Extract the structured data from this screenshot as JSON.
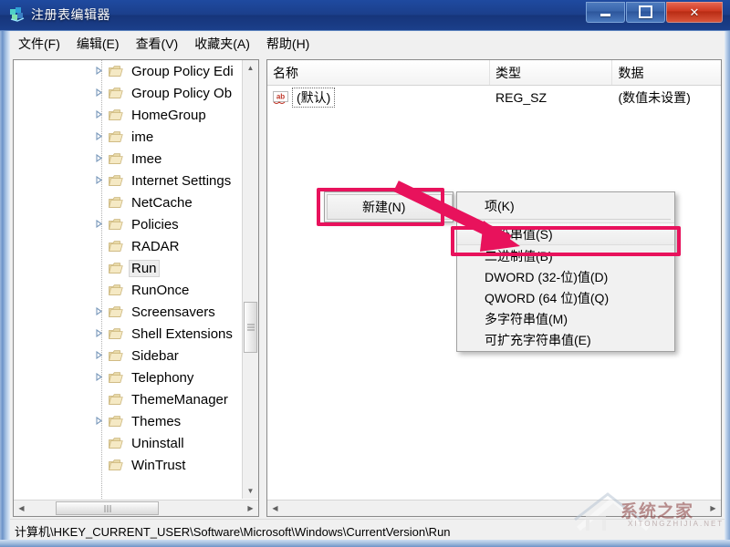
{
  "window": {
    "title": "注册表编辑器",
    "icon": "regedit-icon",
    "controls": {
      "minimize": "最小化",
      "maximize": "最大化",
      "close": "关闭",
      "close_glyph": "✕"
    }
  },
  "menubar": {
    "items": [
      {
        "label": "文件(F)",
        "name": "menu-file"
      },
      {
        "label": "编辑(E)",
        "name": "menu-edit"
      },
      {
        "label": "查看(V)",
        "name": "menu-view"
      },
      {
        "label": "收藏夹(A)",
        "name": "menu-favorites"
      },
      {
        "label": "帮助(H)",
        "name": "menu-help"
      }
    ]
  },
  "tree": {
    "items": [
      {
        "label": "Group Policy Edi",
        "expandable": true,
        "selected": false,
        "truncated": true
      },
      {
        "label": "Group Policy Ob",
        "expandable": true,
        "selected": false,
        "truncated": true
      },
      {
        "label": "HomeGroup",
        "expandable": true,
        "selected": false
      },
      {
        "label": "ime",
        "expandable": true,
        "selected": false
      },
      {
        "label": "Imee",
        "expandable": true,
        "selected": false
      },
      {
        "label": "Internet Settings",
        "expandable": true,
        "selected": false
      },
      {
        "label": "NetCache",
        "expandable": false,
        "selected": false
      },
      {
        "label": "Policies",
        "expandable": true,
        "selected": false
      },
      {
        "label": "RADAR",
        "expandable": false,
        "selected": false
      },
      {
        "label": "Run",
        "expandable": false,
        "selected": true
      },
      {
        "label": "RunOnce",
        "expandable": false,
        "selected": false
      },
      {
        "label": "Screensavers",
        "expandable": true,
        "selected": false
      },
      {
        "label": "Shell Extensions",
        "expandable": true,
        "selected": false
      },
      {
        "label": "Sidebar",
        "expandable": true,
        "selected": false
      },
      {
        "label": "Telephony",
        "expandable": true,
        "selected": false
      },
      {
        "label": "ThemeManager",
        "expandable": false,
        "selected": false
      },
      {
        "label": "Themes",
        "expandable": true,
        "selected": false
      },
      {
        "label": "Uninstall",
        "expandable": false,
        "selected": false
      },
      {
        "label": "WinTrust",
        "expandable": false,
        "selected": false,
        "clipped": true
      }
    ]
  },
  "listview": {
    "columns": [
      "名称",
      "类型",
      "数据"
    ],
    "rows": [
      {
        "name": "(默认)",
        "type": "REG_SZ",
        "data": "(数值未设置)",
        "icon": "string-value-icon"
      }
    ]
  },
  "context_menu": {
    "main_item": "新建(N)",
    "submenu_arrow": "▸",
    "submenu": [
      {
        "label": "项(K)",
        "highlighted": false
      },
      {
        "label": "字符串值(S)",
        "highlighted": true
      },
      {
        "label": "二进制值(B)",
        "highlighted": false
      },
      {
        "label": "DWORD (32-位)值(D)",
        "highlighted": false
      },
      {
        "label": "QWORD (64 位)值(Q)",
        "highlighted": false
      },
      {
        "label": "多字符串值(M)",
        "highlighted": false
      },
      {
        "label": "可扩充字符串值(E)",
        "highlighted": false
      }
    ]
  },
  "statusbar": {
    "path": "计算机\\HKEY_CURRENT_USER\\Software\\Microsoft\\Windows\\CurrentVersion\\Run"
  },
  "annotations": {
    "color": "#e8125c",
    "boxes": [
      "新建(N)",
      "字符串值(S)"
    ],
    "arrow": "points from 新建(N) to 字符串值(S)"
  },
  "watermark": {
    "text": "系统之家",
    "subtext": "XITONGZHIJIA.NET"
  }
}
